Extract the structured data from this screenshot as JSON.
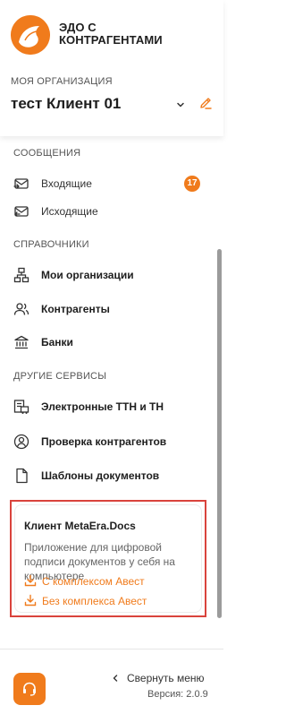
{
  "header": {
    "app_title": "ЭДО С КОНТРАГЕНТАМИ",
    "org_caption": "МОЯ ОРГАНИЗАЦИЯ",
    "org_name": "тест Клиент 01"
  },
  "sidebar": {
    "sections": [
      {
        "title": "СООБЩЕНИЯ",
        "items": [
          {
            "label": "Входящие",
            "icon": "inbox-arrow-icon",
            "badge": "17"
          },
          {
            "label": "Исходящие",
            "icon": "outbox-arrow-icon"
          }
        ]
      },
      {
        "title": "СПРАВОЧНИКИ",
        "items": [
          {
            "label": "Мои организации",
            "icon": "org-structure-icon"
          },
          {
            "label": "Контрагенты",
            "icon": "people-icon"
          },
          {
            "label": "Банки",
            "icon": "bank-icon"
          }
        ]
      },
      {
        "title": "ДРУГИЕ СЕРВИСЫ",
        "items": [
          {
            "label": "Электронные ТТН и ТН",
            "icon": "ttn-icon"
          },
          {
            "label": "Проверка контрагентов",
            "icon": "user-circle-icon"
          },
          {
            "label": "Шаблоны документов",
            "icon": "document-icon"
          }
        ]
      }
    ]
  },
  "promo": {
    "title": "Клиент MetaEra.Docs",
    "description": "Приложение для цифровой подписи документов у себя на компьютере",
    "links": [
      {
        "label": "С комплексом Авест",
        "icon": "download-icon"
      },
      {
        "label": "Без комплекса Авест",
        "icon": "download-icon"
      }
    ]
  },
  "footer": {
    "collapse_label": "Свернуть меню",
    "version": "Версия: 2.0.9"
  },
  "colors": {
    "accent": "#f07b1c",
    "highlight_border": "#d9433c",
    "text": "#1e1e1e",
    "muted": "#555555"
  }
}
